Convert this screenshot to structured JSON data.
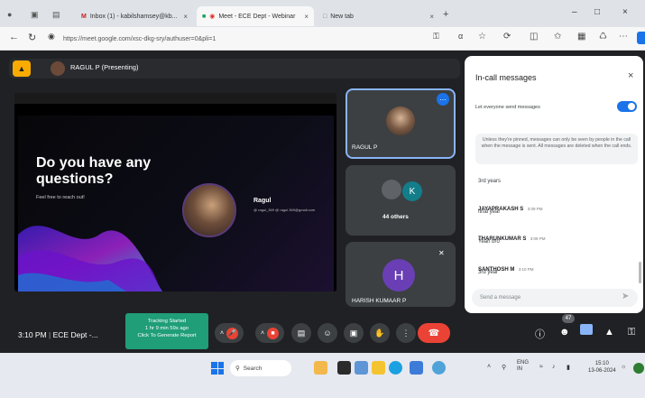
{
  "browser": {
    "tabs": [
      {
        "label": "Inbox (1) - kabilshamsey@kb...",
        "active": false
      },
      {
        "label": "Meet - ECE Dept - Webinar",
        "active": true
      },
      {
        "label": "New tab",
        "active": false
      }
    ],
    "url": "https://meet.google.com/xsc-dkg-sry/authuser=0&pli=1"
  },
  "meet": {
    "presenter_label": "RAGUL P (Presenting)",
    "slide": {
      "heading": "Do you have any questions?",
      "subtext": "Feel free to reach out!",
      "name": "Ragul",
      "details": "@ ragul_369 @ ragul.369@gmail.com"
    },
    "tiles": [
      {
        "name": "RAGUL P"
      },
      {
        "name": "44 others",
        "initial": "K"
      },
      {
        "name": "HARISH KUMAAR P",
        "initial": "H"
      }
    ],
    "time": "3:10 PM",
    "meeting_name": "ECE Dept -...",
    "tracking_box": {
      "line1": "Tracking Started",
      "line2": "1 hr 9 min 59s ago",
      "line3": "Click To Generate Report"
    },
    "people_count": "47"
  },
  "chat": {
    "title": "In-call messages",
    "toggle_label": "Let everyone send messages",
    "toggle_on": true,
    "info": "Unless they're pinned, messages can only be seen by people in the call when the message is sent. All messages are deleted when the call ends.",
    "messages": [
      {
        "sender": "",
        "time": "",
        "text": "3rd years"
      },
      {
        "sender": "JAYAPRAKASH S",
        "time": "3:09 PM",
        "text": "final year"
      },
      {
        "sender": "THARUNKUMAR S",
        "time": "3:09 PM",
        "text": "Yeah bro"
      },
      {
        "sender": "SANTHOSH M",
        "time": "3:10 PM",
        "text": "3rd year"
      }
    ],
    "input_placeholder": "Send a message"
  },
  "taskbar": {
    "search_label": "Search",
    "lang": "ENG",
    "region": "IN",
    "time": "15:10",
    "date": "13-06-2024"
  }
}
